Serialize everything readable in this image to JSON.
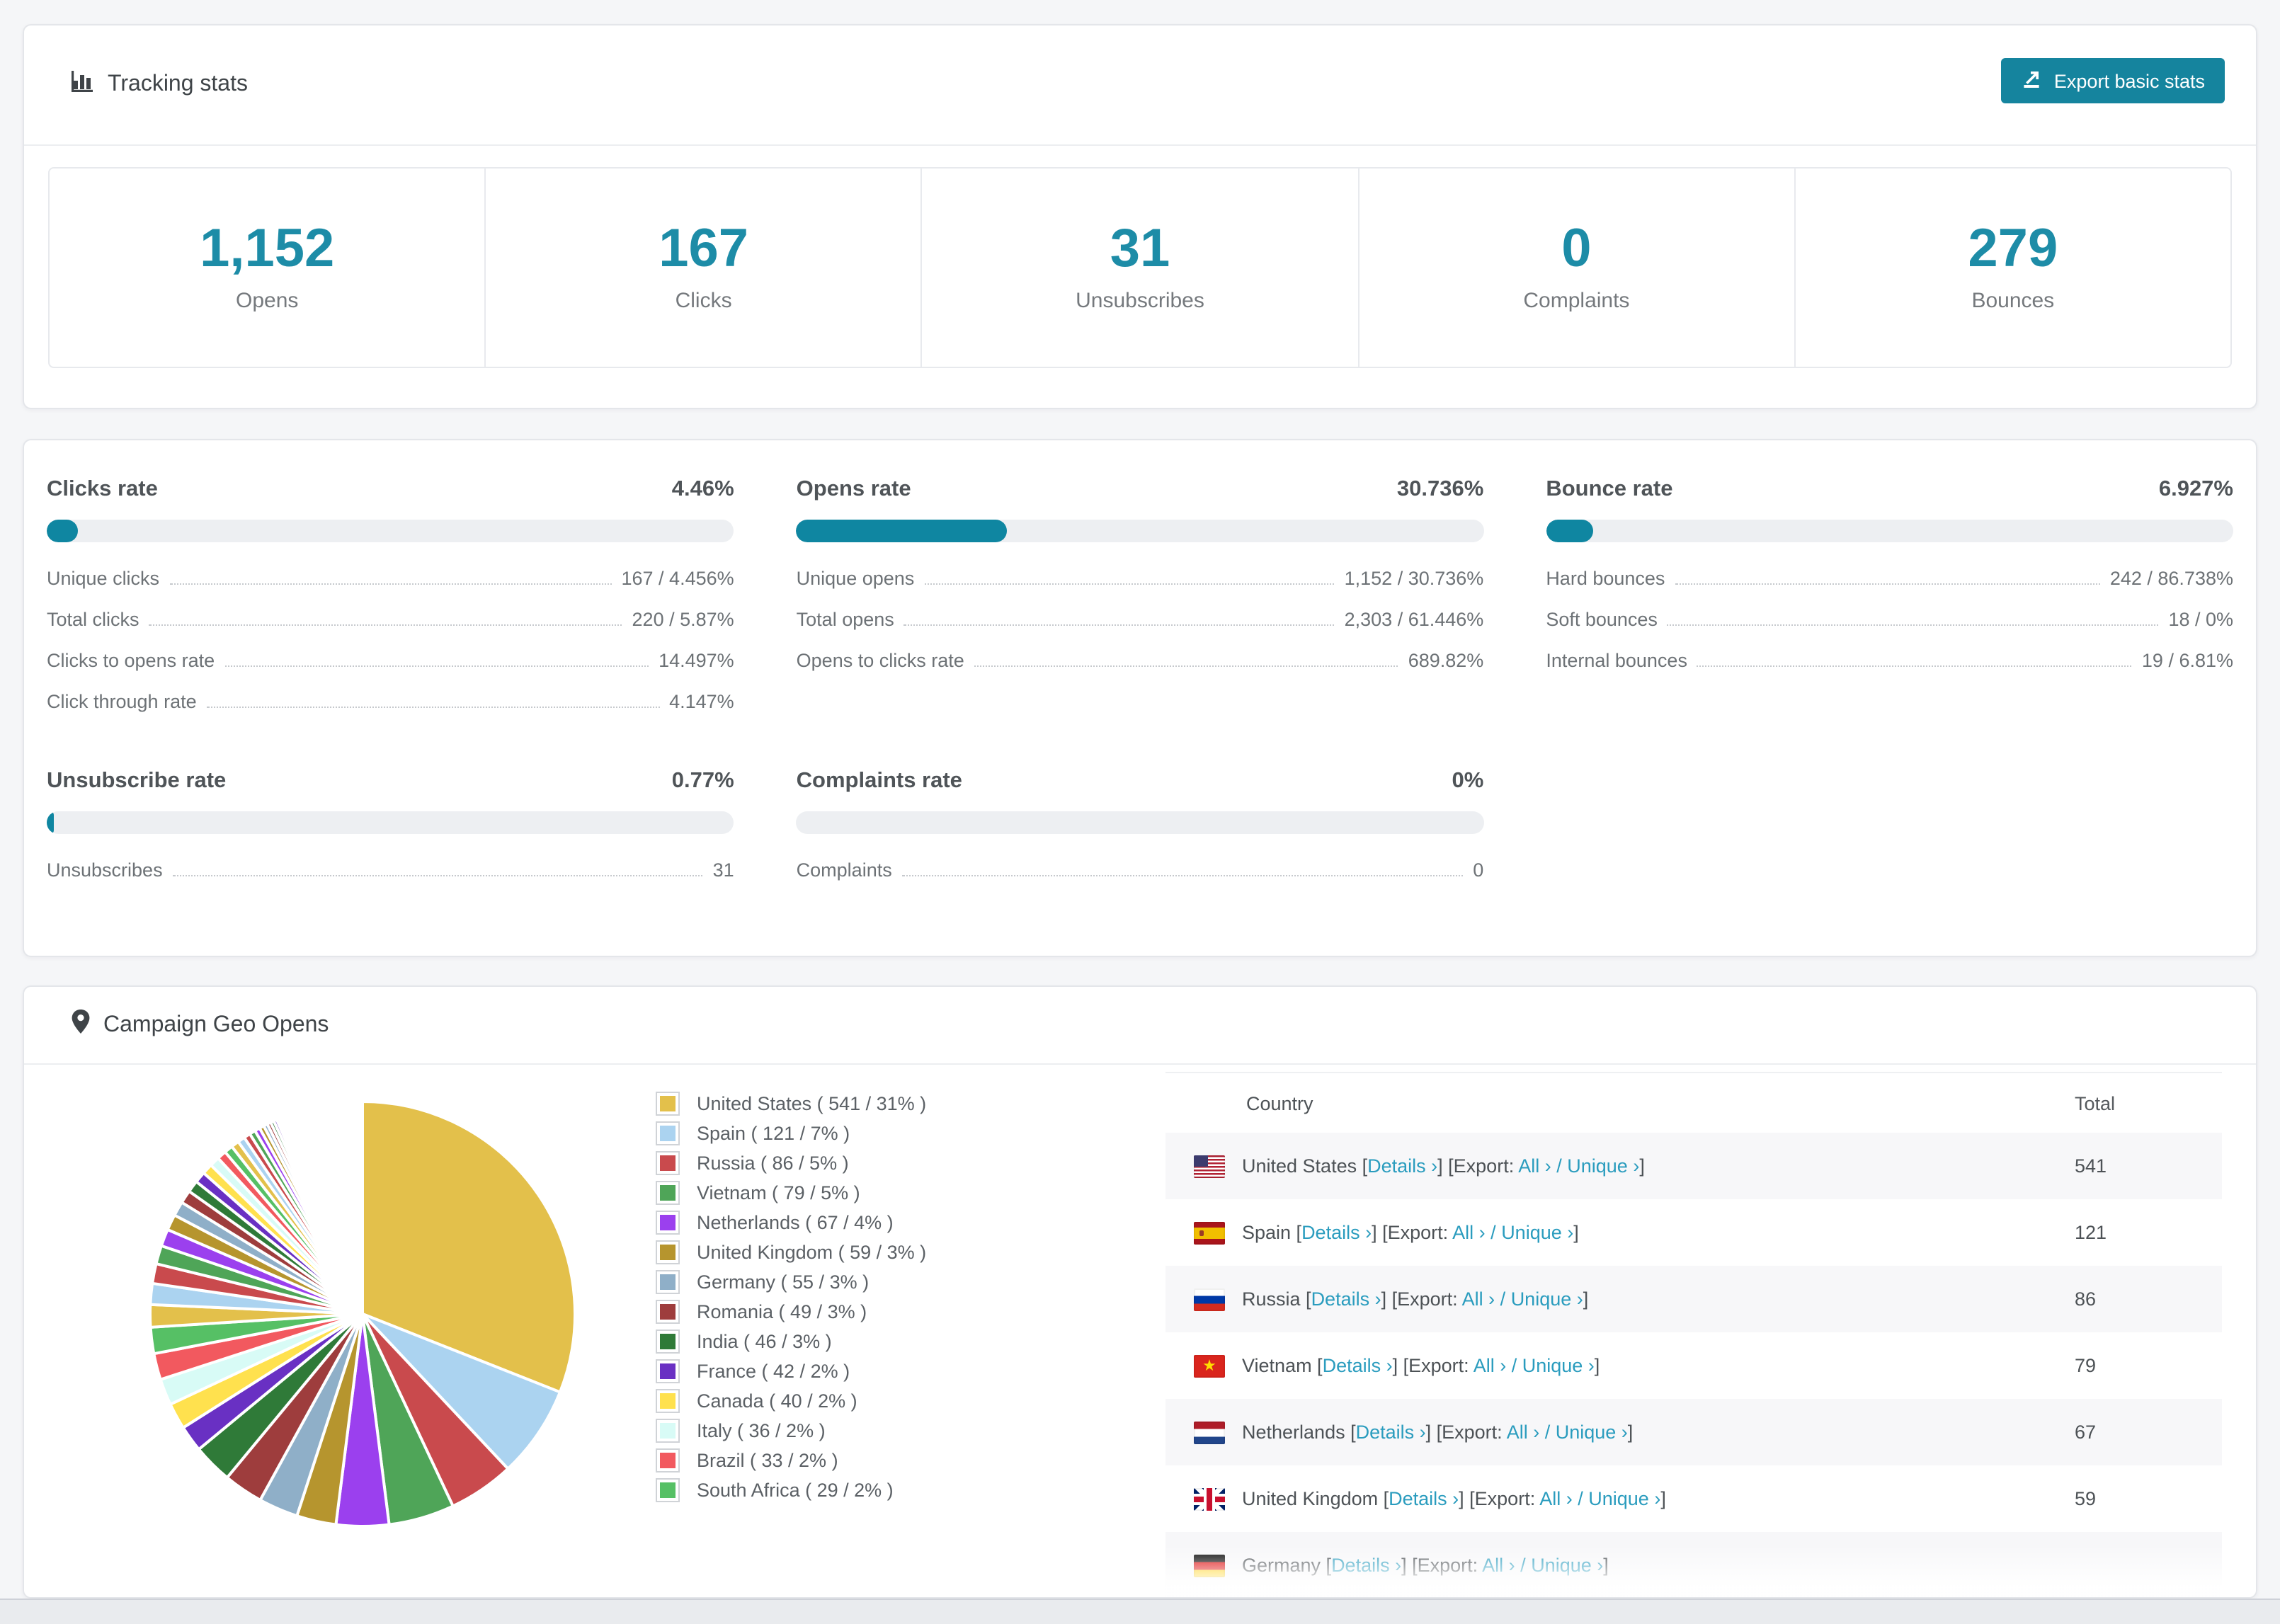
{
  "tracking": {
    "title": "Tracking stats",
    "export_button": "Export basic stats",
    "summary": [
      {
        "value": "1,152",
        "label": "Opens"
      },
      {
        "value": "167",
        "label": "Clicks"
      },
      {
        "value": "31",
        "label": "Unsubscribes"
      },
      {
        "value": "0",
        "label": "Complaints"
      },
      {
        "value": "279",
        "label": "Bounces"
      }
    ]
  },
  "rates": {
    "blocks": [
      {
        "title": "Clicks rate",
        "value": "4.46%",
        "percent": 4.46,
        "rows": [
          [
            "Unique clicks",
            "167 / 4.456%"
          ],
          [
            "Total clicks",
            "220 / 5.87%"
          ],
          [
            "Clicks to opens rate",
            "14.497%"
          ],
          [
            "Click through rate",
            "4.147%"
          ]
        ]
      },
      {
        "title": "Opens rate",
        "value": "30.736%",
        "percent": 30.736,
        "rows": [
          [
            "Unique opens",
            "1,152 / 30.736%"
          ],
          [
            "Total opens",
            "2,303 / 61.446%"
          ],
          [
            "Opens to clicks rate",
            "689.82%"
          ]
        ]
      },
      {
        "title": "Bounce rate",
        "value": "6.927%",
        "percent": 6.927,
        "rows": [
          [
            "Hard bounces",
            "242 / 86.738%"
          ],
          [
            "Soft bounces",
            "18 / 0%"
          ],
          [
            "Internal bounces",
            "19 / 6.81%"
          ]
        ]
      },
      {
        "title": "Unsubscribe rate",
        "value": "0.77%",
        "percent": 0.77,
        "rows": [
          [
            "Unsubscribes",
            "31"
          ]
        ]
      },
      {
        "title": "Complaints rate",
        "value": "0%",
        "percent": 0,
        "rows": [
          [
            "Complaints",
            "0"
          ]
        ]
      }
    ]
  },
  "geo": {
    "title": "Campaign Geo Opens",
    "legend_note": "name ( count / pct )",
    "table": {
      "headers": [
        "Country",
        "Total"
      ],
      "link_labels": {
        "details": "Details ›",
        "export_prefix": "Export:",
        "all": "All ›",
        "unique": "Unique ›"
      },
      "rows": [
        {
          "country": "United States",
          "flag": "us",
          "total": "541"
        },
        {
          "country": "Spain",
          "flag": "es",
          "total": "121"
        },
        {
          "country": "Russia",
          "flag": "ru",
          "total": "86"
        },
        {
          "country": "Vietnam",
          "flag": "vn",
          "total": "79"
        },
        {
          "country": "Netherlands",
          "flag": "nl",
          "total": "67"
        },
        {
          "country": "United Kingdom",
          "flag": "gb",
          "total": "59"
        },
        {
          "country": "Germany",
          "flag": "de",
          "total": "",
          "partial": true
        }
      ]
    }
  },
  "chart_data": {
    "type": "pie",
    "title": "Campaign Geo Opens",
    "legend_position": "right",
    "slices": [
      {
        "label": "United States",
        "count": 541,
        "pct": 31,
        "color": "#E3C04B",
        "legend": "United States ( 541 / 31% )"
      },
      {
        "label": "Spain",
        "count": 121,
        "pct": 7,
        "color": "#ABD3F0",
        "legend": "Spain ( 121 / 7% )"
      },
      {
        "label": "Russia",
        "count": 86,
        "pct": 5,
        "color": "#C94A4D",
        "legend": "Russia ( 86 / 5% )"
      },
      {
        "label": "Vietnam",
        "count": 79,
        "pct": 5,
        "color": "#4FA558",
        "legend": "Vietnam ( 79 / 5% )"
      },
      {
        "label": "Netherlands",
        "count": 67,
        "pct": 4,
        "color": "#9B40EE",
        "legend": "Netherlands ( 67 / 4% )"
      },
      {
        "label": "United Kingdom",
        "count": 59,
        "pct": 3,
        "color": "#B6952E",
        "legend": "United Kingdom ( 59 / 3% )"
      },
      {
        "label": "Germany",
        "count": 55,
        "pct": 3,
        "color": "#8FAFC8",
        "legend": "Germany ( 55 / 3% )"
      },
      {
        "label": "Romania",
        "count": 49,
        "pct": 3,
        "color": "#9E3D3D",
        "legend": "Romania ( 49 / 3% )"
      },
      {
        "label": "India",
        "count": 46,
        "pct": 3,
        "color": "#2F7A38",
        "legend": "India ( 46 / 3% )"
      },
      {
        "label": "France",
        "count": 42,
        "pct": 2,
        "color": "#6930C3",
        "legend": "France ( 42 / 2% )"
      },
      {
        "label": "Canada",
        "count": 40,
        "pct": 2,
        "color": "#FFE14E",
        "legend": "Canada ( 40 / 2% )"
      },
      {
        "label": "Italy",
        "count": 36,
        "pct": 2,
        "color": "#D8FBF6",
        "legend": "Italy ( 36 / 2% )"
      },
      {
        "label": "Brazil",
        "count": 33,
        "pct": 2,
        "color": "#F2595F",
        "legend": "Brazil ( 33 / 2% )"
      },
      {
        "label": "South Africa",
        "count": 29,
        "pct": 2,
        "color": "#56C065",
        "legend": "South Africa ( 29 / 2% )"
      }
    ],
    "tail_percents": [
      1.7,
      1.6,
      1.5,
      1.4,
      1.3,
      1.2,
      1.1,
      1.0,
      0.9,
      0.85,
      0.8,
      0.75,
      0.7,
      0.65,
      0.6,
      0.55,
      0.5,
      0.45,
      0.4,
      0.35,
      0.3,
      0.28,
      0.26,
      0.24,
      0.22,
      0.2,
      0.18,
      0.16,
      0.14,
      0.12,
      0.1,
      0.09,
      0.08,
      0.07,
      0.06,
      0.05
    ],
    "start_angle_deg": -90,
    "direction": "clockwise"
  },
  "colors": {
    "accent_teal": "#0f86a1",
    "number_teal": "#1d8ca7",
    "link_teal": "#2a9cbe",
    "button_teal": "#15849e",
    "track_gray": "#edeff2",
    "page_bg": "#f5f6f8"
  }
}
